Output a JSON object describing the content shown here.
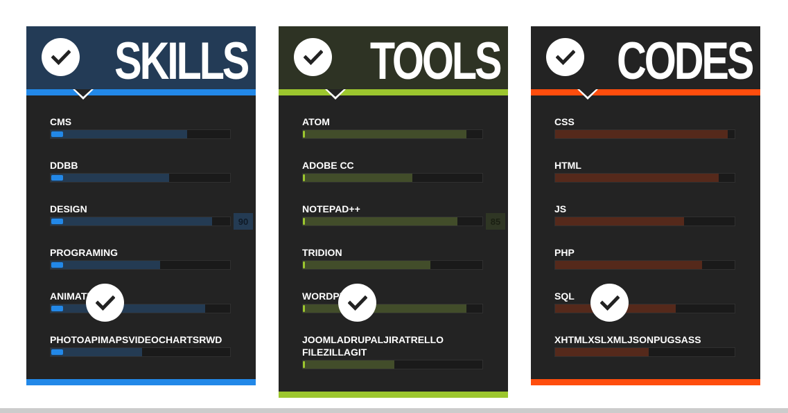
{
  "colors": {
    "skills_accent": "#2288e8",
    "tools_accent": "#9cc62e",
    "codes_accent": "#ff4d0d",
    "card_bg": "#232323"
  },
  "cards": [
    {
      "title": "SKILLS",
      "icon": "check-icon",
      "skills": [
        {
          "label": "CMS",
          "level_percent": 76
        },
        {
          "label": "DDBB",
          "level_percent": 66
        },
        {
          "label": "DESIGN",
          "level_percent": 90,
          "value": "90"
        },
        {
          "label": "PROGRAMING",
          "level_percent": 61
        },
        {
          "label": "ANIMATION",
          "level_percent": 86
        },
        {
          "label": "PHOTOAPIMAPSVIDEOCHARTSRWD",
          "level_percent": 51
        }
      ]
    },
    {
      "title": "TOOLS",
      "icon": "check-icon",
      "skills": [
        {
          "label": "ATOM",
          "level_percent": 91
        },
        {
          "label": "ADOBE CC",
          "level_percent": 61
        },
        {
          "label": "NOTEPAD++",
          "level_percent": 86,
          "value": "85"
        },
        {
          "label": "TRIDION",
          "level_percent": 71
        },
        {
          "label": "WORDPRESS",
          "level_percent": 91
        },
        {
          "label": "JOOMLADRUPALJIRATRELLO FILEZILLAGIT",
          "level_percent": 51
        }
      ]
    },
    {
      "title": "CODES",
      "icon": "check-icon",
      "skills": [
        {
          "label": "CSS",
          "level_percent": 96
        },
        {
          "label": "HTML",
          "level_percent": 91
        },
        {
          "label": "JS",
          "level_percent": 72
        },
        {
          "label": "PHP",
          "level_percent": 82
        },
        {
          "label": "SQL",
          "level_percent": 67
        },
        {
          "label": "XHTMLXSLXMLJSONPUGSASS",
          "level_percent": 52
        }
      ]
    }
  ]
}
